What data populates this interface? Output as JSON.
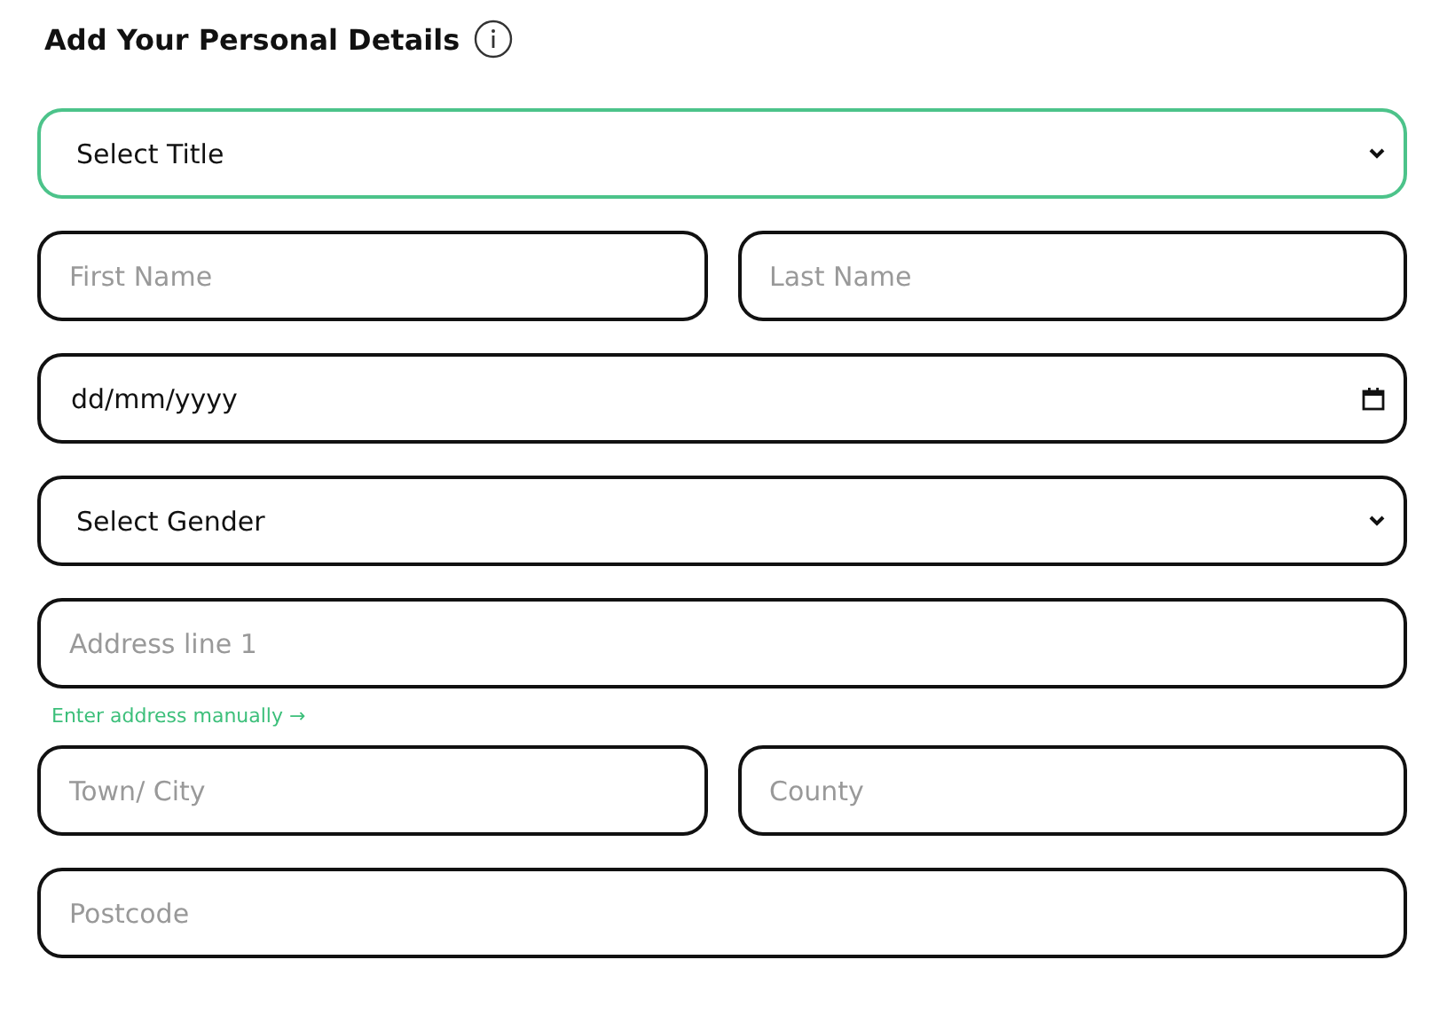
{
  "heading": "Add Your Personal Details",
  "form": [
    {
      "kind": "select",
      "label": "Select Title",
      "focused": true
    },
    {
      "kind": "row",
      "fields": [
        {
          "placeholder": "First Name"
        },
        {
          "placeholder": "Last Name"
        }
      ]
    },
    {
      "kind": "date",
      "placeholder": "dd/mm/yyyy",
      "focused": false
    },
    {
      "kind": "select",
      "label": "Select Gender",
      "focused": false
    },
    {
      "kind": "row",
      "fields": [
        {
          "placeholder": "Address line 1"
        }
      ]
    },
    {
      "kind": "link",
      "label": "Enter address manually →"
    },
    {
      "kind": "row",
      "fields": [
        {
          "placeholder": "Town/ City"
        },
        {
          "placeholder": "County"
        }
      ]
    },
    {
      "kind": "row",
      "fields": [
        {
          "placeholder": "Postcode"
        }
      ]
    }
  ]
}
